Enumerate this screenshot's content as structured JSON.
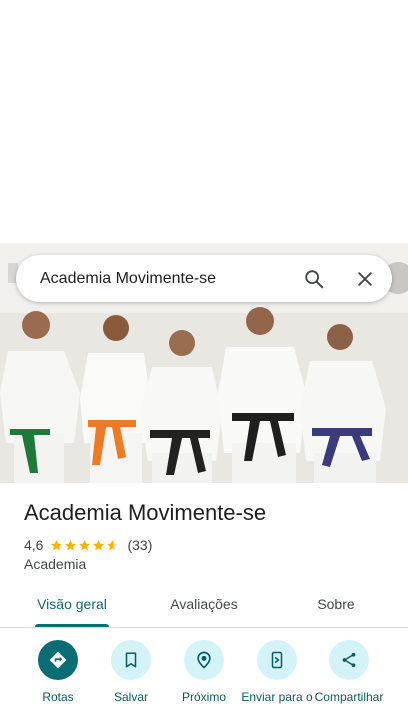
{
  "search": {
    "query": "Academia Movimente-se"
  },
  "place": {
    "name": "Academia Movimente-se",
    "rating": "4,6",
    "rating_value": 4.6,
    "review_count": "(33)",
    "category": "Academia"
  },
  "tabs": [
    {
      "label": "Visão geral",
      "active": true
    },
    {
      "label": "Avaliações",
      "active": false
    },
    {
      "label": "Sobre",
      "active": false
    }
  ],
  "actions": [
    {
      "label": "Rotas",
      "icon": "directions-icon"
    },
    {
      "label": "Salvar",
      "icon": "bookmark-icon"
    },
    {
      "label": "Próximo",
      "icon": "nearby-icon"
    },
    {
      "label": "Enviar para o",
      "icon": "send-to-phone-icon"
    },
    {
      "label": "Compartilhar",
      "icon": "share-icon"
    }
  ],
  "colors": {
    "accent": "#0b6c73",
    "action_bg": "#d3f3f9",
    "star": "#f4b400"
  }
}
